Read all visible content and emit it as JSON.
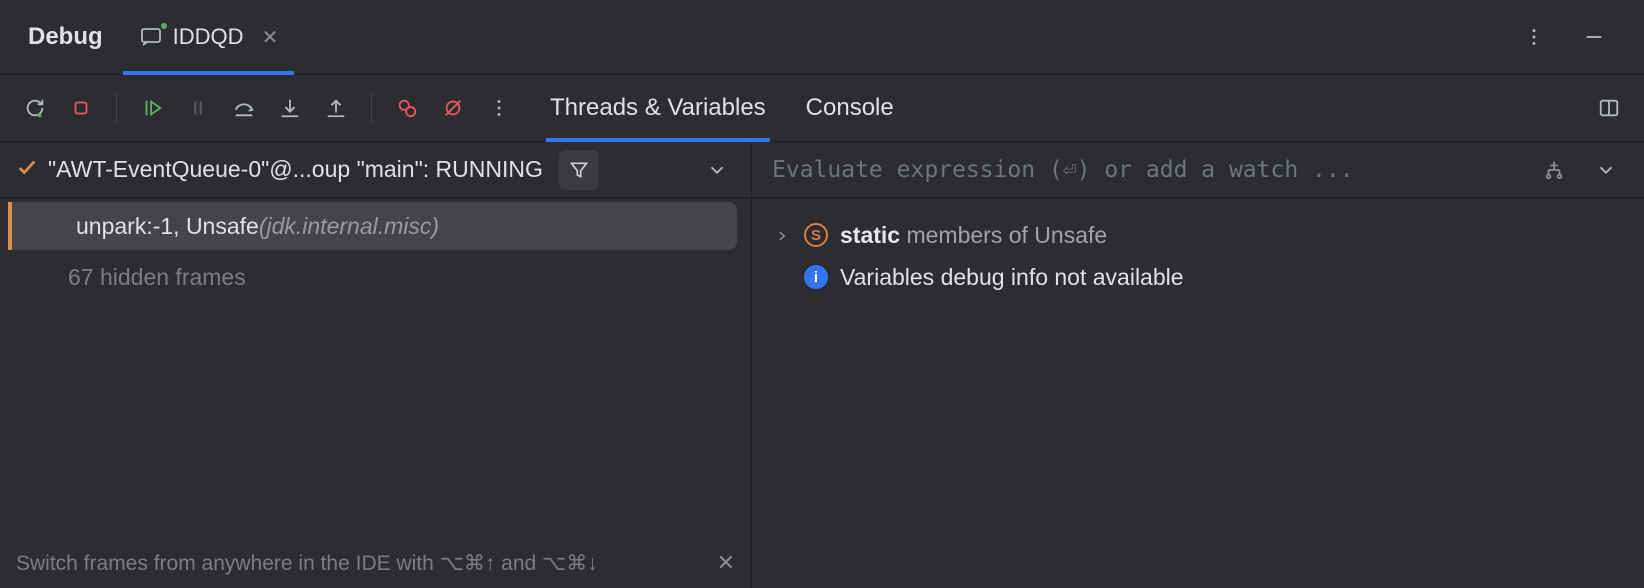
{
  "header": {
    "title": "Debug",
    "tab_label": "IDDQD"
  },
  "inner_tabs": {
    "threads_vars": "Threads & Variables",
    "console": "Console"
  },
  "thread": {
    "label": "\"AWT-EventQueue-0\"@...oup \"main\": RUNNING"
  },
  "frames": {
    "top": {
      "method": "unpark:-1, Unsafe ",
      "pkg": "(jdk.internal.misc)"
    },
    "hidden": "67 hidden frames"
  },
  "tip": {
    "text": "Switch frames from anywhere in the IDE with ⌥⌘↑ and ⌥⌘↓"
  },
  "eval": {
    "placeholder": "Evaluate expression (⏎) or add a watch ..."
  },
  "vars": {
    "static_bold": "static",
    "static_rest": " members of Unsafe",
    "info": "Variables debug info not available"
  }
}
